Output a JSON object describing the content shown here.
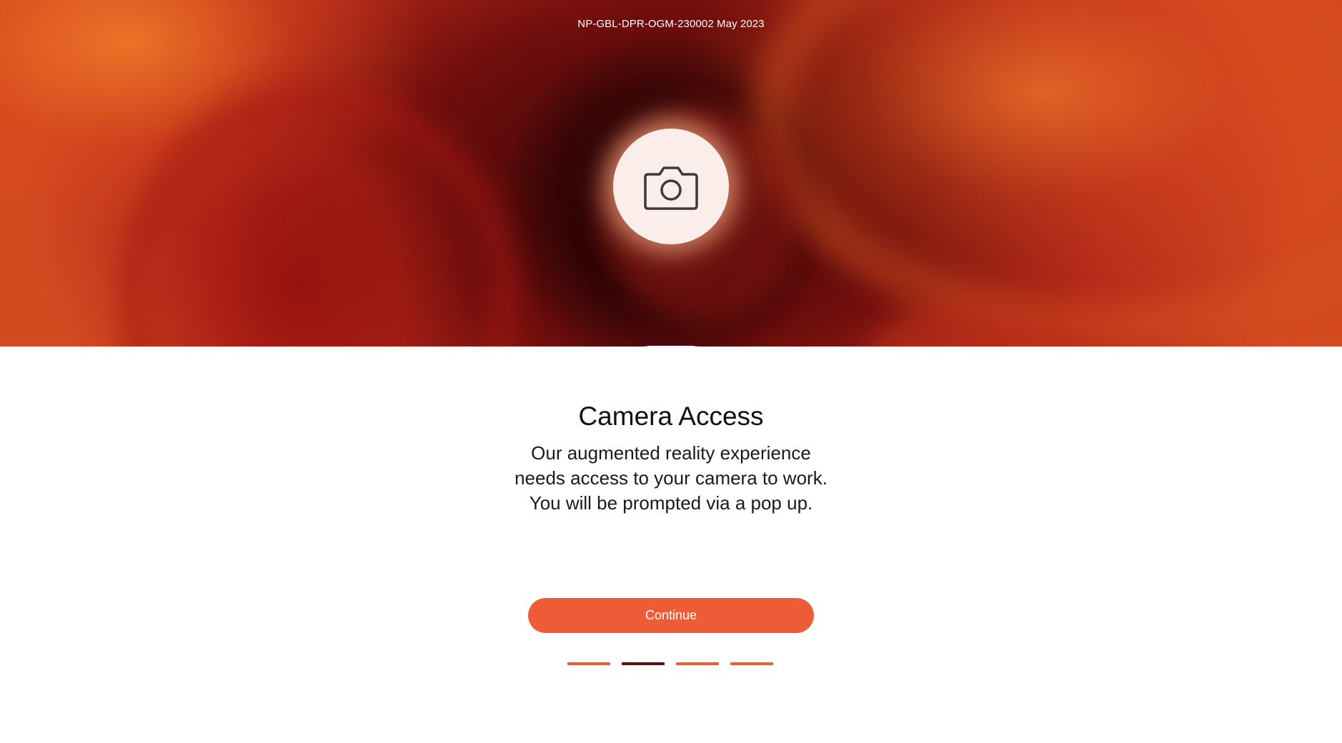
{
  "header": {
    "reference_code": "NP-GBL-DPR-OGM-230002 May 2023"
  },
  "icon": {
    "name": "camera-icon"
  },
  "main": {
    "title": "Camera Access",
    "description": "Our augmented reality experience needs access to your camera to work. You will be prompted via a pop up.",
    "continue_label": "Continue"
  },
  "pagination": {
    "total": 4,
    "active_index": 1
  },
  "colors": {
    "accent": "#ee5b37",
    "active_step": "#5c0d0f",
    "icon_bg": "#fbeeea",
    "text": "#111111"
  }
}
